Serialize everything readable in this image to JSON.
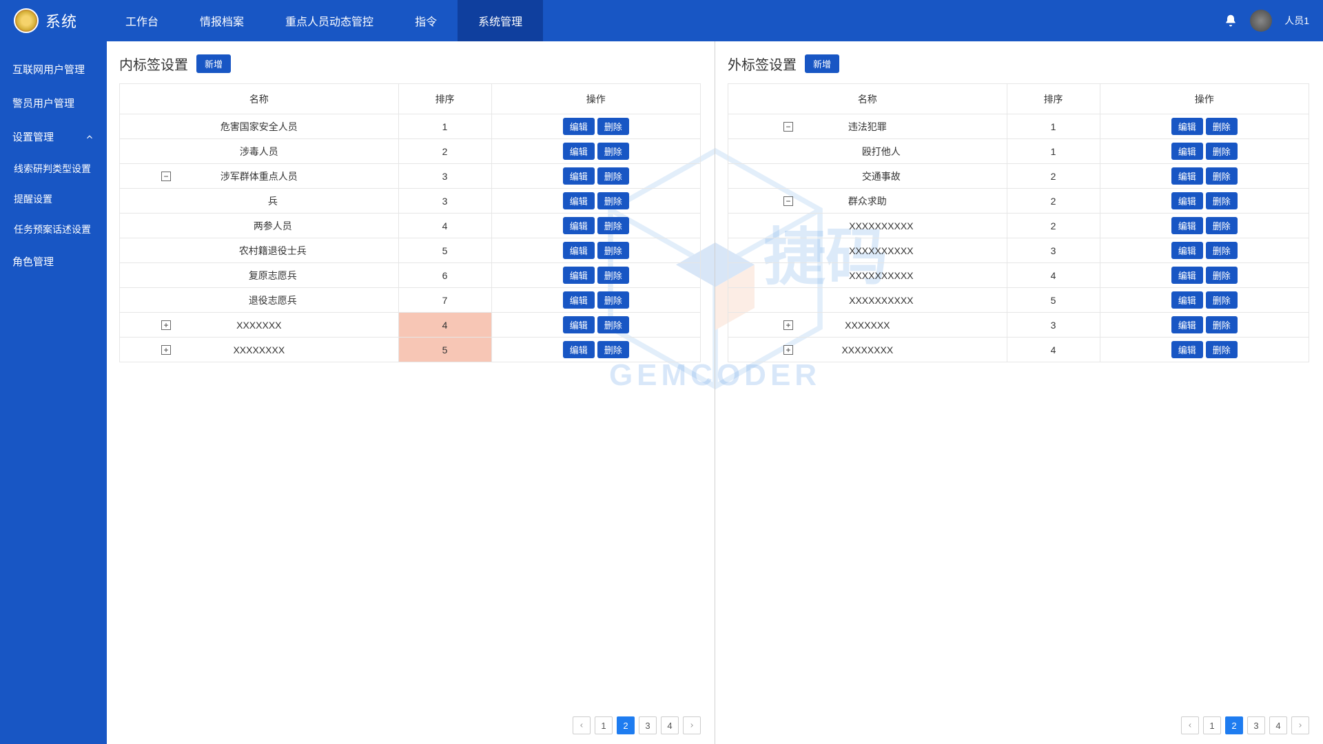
{
  "header": {
    "app_name": "系统",
    "nav": [
      "工作台",
      "情报档案",
      "重点人员动态管控",
      "指令",
      "系统管理"
    ],
    "active_nav_index": 4,
    "user_name": "人员1"
  },
  "sidebar": {
    "items": [
      {
        "label": "互联网用户管理",
        "type": "item"
      },
      {
        "label": "警员用户管理",
        "type": "item"
      },
      {
        "label": "设置管理",
        "type": "expandable",
        "expanded": true,
        "children": [
          "线索研判类型设置",
          "提醒设置",
          "任务预案话述设置"
        ]
      },
      {
        "label": "角色管理",
        "type": "item"
      }
    ]
  },
  "left_panel": {
    "title": "内标签设置",
    "add_label": "新增",
    "columns": [
      "名称",
      "排序",
      "操作"
    ],
    "edit_label": "编辑",
    "delete_label": "删除",
    "rows": [
      {
        "name": "危害国家安全人员",
        "sort": "1",
        "tree": null,
        "indent": 0,
        "hl": false
      },
      {
        "name": "涉毒人员",
        "sort": "2",
        "tree": null,
        "indent": 0,
        "hl": false
      },
      {
        "name": "涉军群体重点人员",
        "sort": "3",
        "tree": "minus",
        "indent": 0,
        "hl": false
      },
      {
        "name": "兵",
        "sort": "3",
        "tree": null,
        "indent": 1,
        "hl": false
      },
      {
        "name": "两参人员",
        "sort": "4",
        "tree": null,
        "indent": 1,
        "hl": false
      },
      {
        "name": "农村籍退役士兵",
        "sort": "5",
        "tree": null,
        "indent": 1,
        "hl": false
      },
      {
        "name": "复原志愿兵",
        "sort": "6",
        "tree": null,
        "indent": 1,
        "hl": false
      },
      {
        "name": "退役志愿兵",
        "sort": "7",
        "tree": null,
        "indent": 1,
        "hl": false
      },
      {
        "name": "XXXXXXX",
        "sort": "4",
        "tree": "plus",
        "indent": 0,
        "hl": true
      },
      {
        "name": "XXXXXXXX",
        "sort": "5",
        "tree": "plus",
        "indent": 0,
        "hl": true
      }
    ],
    "pager": {
      "prev": "<",
      "pages": [
        "1",
        "2",
        "3",
        "4"
      ],
      "next": ">",
      "active": 1
    }
  },
  "right_panel": {
    "title": "外标签设置",
    "add_label": "新增",
    "columns": [
      "名称",
      "排序",
      "操作"
    ],
    "edit_label": "编辑",
    "delete_label": "删除",
    "rows": [
      {
        "name": "违法犯罪",
        "sort": "1",
        "tree": "minus",
        "indent": 0
      },
      {
        "name": "殴打他人",
        "sort": "1",
        "tree": null,
        "indent": 1
      },
      {
        "name": "交通事故",
        "sort": "2",
        "tree": null,
        "indent": 1
      },
      {
        "name": "群众求助",
        "sort": "2",
        "tree": "minus",
        "indent": 0
      },
      {
        "name": "XXXXXXXXXX",
        "sort": "2",
        "tree": null,
        "indent": 1
      },
      {
        "name": "XXXXXXXXXX",
        "sort": "3",
        "tree": null,
        "indent": 1
      },
      {
        "name": "XXXXXXXXXX",
        "sort": "4",
        "tree": null,
        "indent": 1
      },
      {
        "name": "XXXXXXXXXX",
        "sort": "5",
        "tree": null,
        "indent": 1
      },
      {
        "name": "XXXXXXX",
        "sort": "3",
        "tree": "plus",
        "indent": 0
      },
      {
        "name": "XXXXXXXX",
        "sort": "4",
        "tree": "plus",
        "indent": 0
      }
    ],
    "pager": {
      "prev": "<",
      "pages": [
        "1",
        "2",
        "3",
        "4"
      ],
      "next": ">",
      "active": 1
    }
  },
  "watermark": {
    "text_en": "GEMCODER",
    "text_cn": "捷码"
  }
}
